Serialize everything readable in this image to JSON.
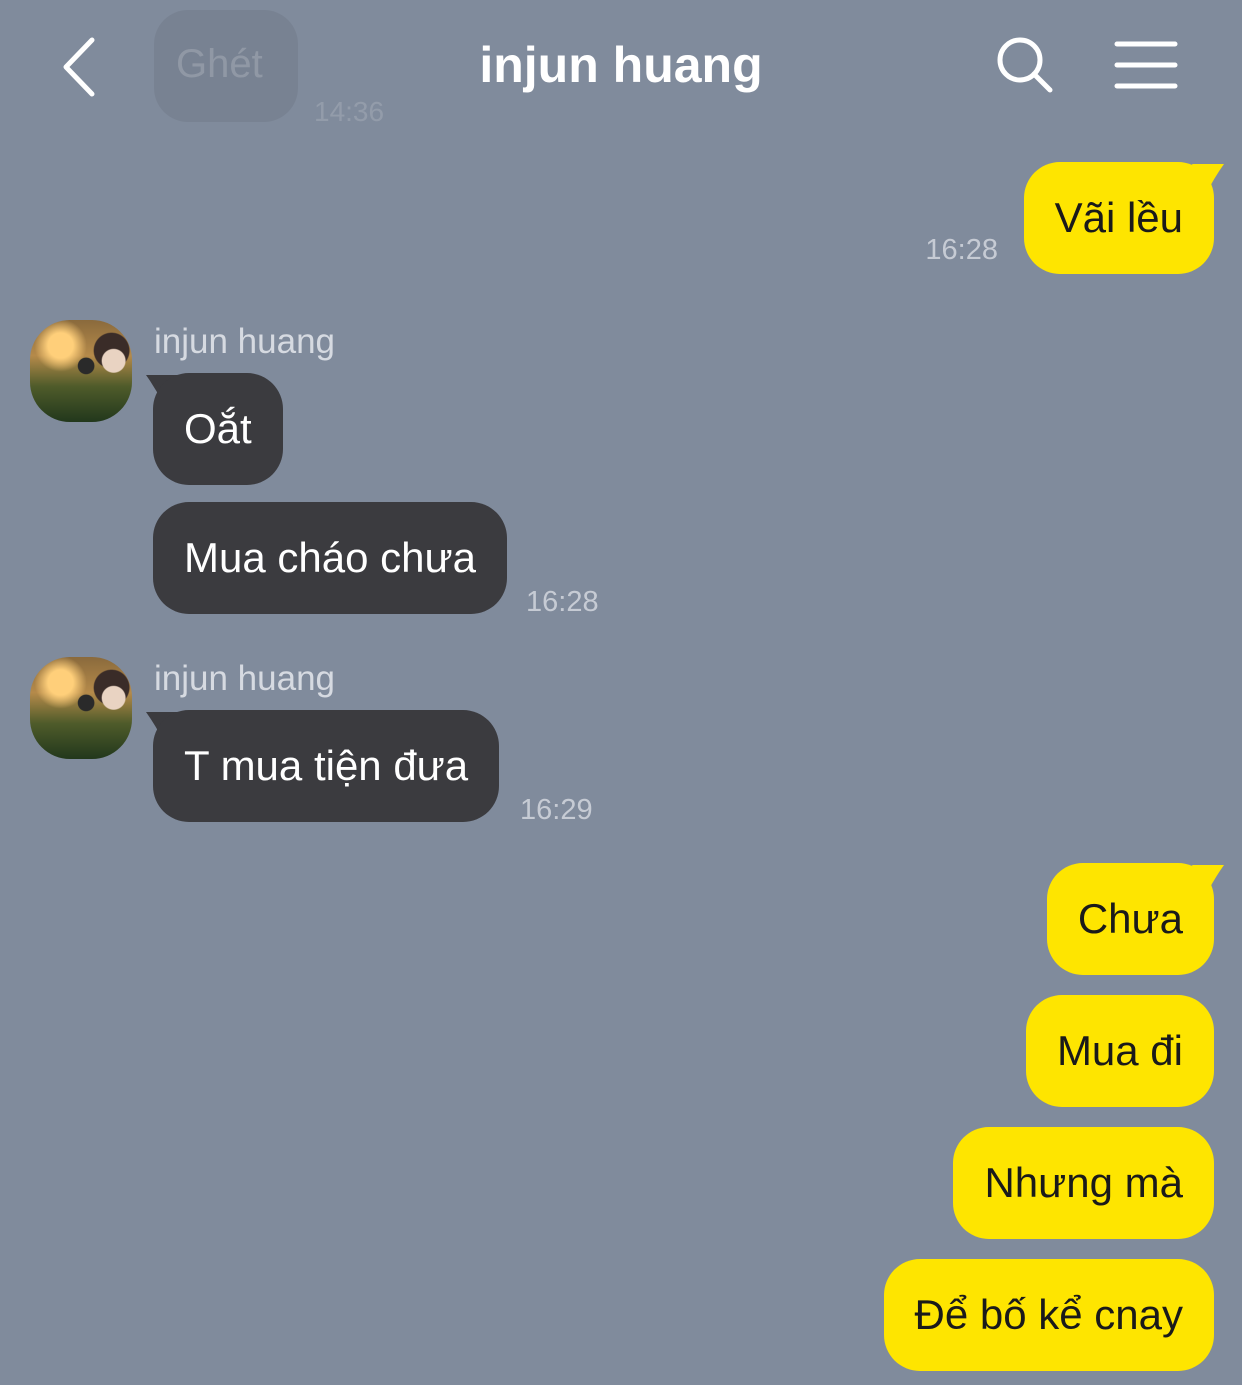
{
  "header": {
    "title": "injun huang",
    "faded_preview_text": "Ghét",
    "faded_preview_time": "14:36"
  },
  "messages": [
    {
      "from": "me",
      "text": "Vãi lều",
      "time": "16:28"
    },
    {
      "from": "them",
      "sender": "injun huang",
      "text": "Oắt"
    },
    {
      "from": "them",
      "text": "Mua cháo chưa",
      "time": "16:28"
    },
    {
      "from": "them",
      "sender": "injun huang",
      "text": "T mua tiện đưa",
      "time": "16:29"
    },
    {
      "from": "me",
      "text": "Chưa"
    },
    {
      "from": "me",
      "text": "Mua đi"
    },
    {
      "from": "me",
      "text": "Nhưng mà"
    },
    {
      "from": "me",
      "text": "Để bố kể cnay"
    }
  ],
  "icons": [
    "back-chevron-icon",
    "search-icon",
    "menu-icon"
  ],
  "colors": {
    "background": "#808b9c",
    "my_bubble": "#fee500",
    "their_bubble": "#3b3b3f"
  }
}
